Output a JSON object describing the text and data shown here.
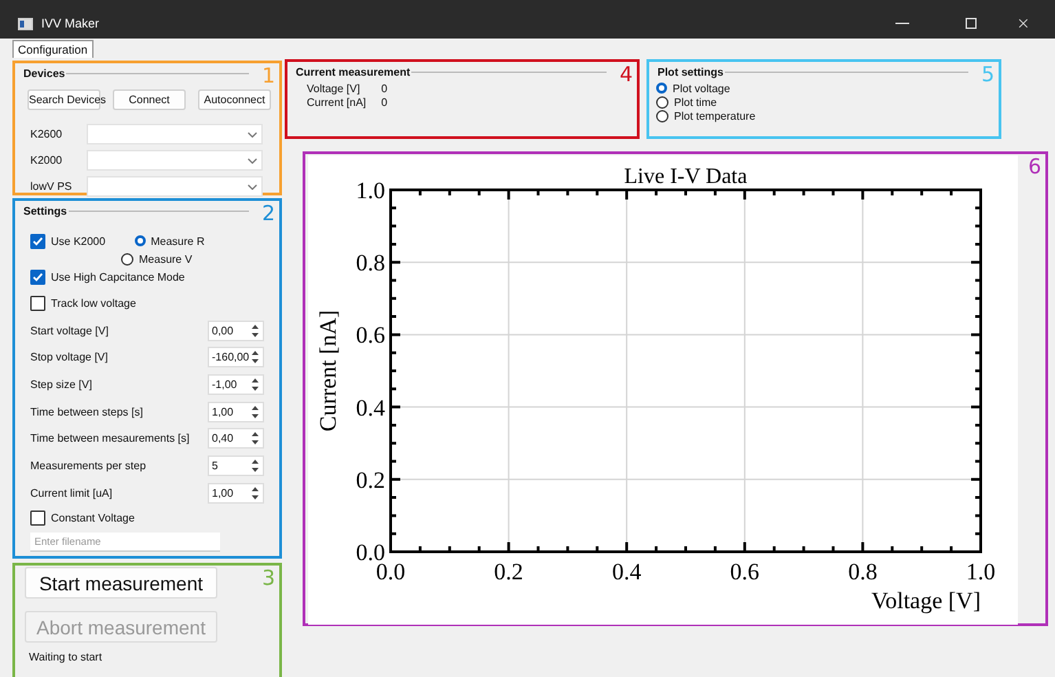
{
  "window": {
    "title": "IVV Maker"
  },
  "tabs": [
    {
      "label": "Configuration",
      "selected": true
    }
  ],
  "devices": {
    "title": "Devices",
    "marker": {
      "label": "1",
      "color": "#f7a030"
    },
    "buttons": [
      "Search Devices",
      "Connect",
      "Autoconnect"
    ],
    "selectors": [
      {
        "label": "K2600"
      },
      {
        "label": "K2000"
      },
      {
        "label": "lowV PS"
      }
    ]
  },
  "settings": {
    "title": "Settings",
    "marker": {
      "label": "2",
      "color": "#1e8fd6"
    },
    "use_k2000": {
      "label": "Use K2000",
      "checked": true
    },
    "measure_mode": [
      {
        "label": "Measure R",
        "selected": true
      },
      {
        "label": "Measure V",
        "selected": false
      }
    ],
    "high_capacitance": {
      "label": "Use High Capcitance Mode",
      "checked": true
    },
    "track_low_voltage": {
      "label": "Track low voltage",
      "checked": false
    },
    "parameters": [
      {
        "label": "Start voltage [V]",
        "value": "0,00"
      },
      {
        "label": "Stop voltage [V]",
        "value": "-160,00"
      },
      {
        "label": "Step size [V]",
        "value": "-1,00"
      },
      {
        "label": "Time between steps [s]",
        "value": "1,00"
      },
      {
        "label": "Time between mesaurements [s]",
        "value": "0,40"
      },
      {
        "label": "Measurements per step",
        "value": "5"
      },
      {
        "label": "Current limit [uA]",
        "value": "1,00"
      }
    ],
    "constant_voltage": {
      "label": "Constant Voltage",
      "checked": false
    },
    "filename": {
      "placeholder": "Enter filename"
    }
  },
  "controls": {
    "marker": {
      "label": "3",
      "color": "#7ab648"
    },
    "buttons": [
      {
        "label": "Start measurement",
        "disabled": false
      },
      {
        "label": "Abort measurement",
        "disabled": true
      }
    ],
    "status": "Waiting to start"
  },
  "current_measurement": {
    "title": "Current measurement",
    "marker": {
      "label": "4",
      "color": "#d0101e"
    },
    "readings": [
      {
        "label": "Voltage [V]",
        "value": "0"
      },
      {
        "label": "Current [nA]",
        "value": "0"
      }
    ]
  },
  "plot_settings": {
    "title": "Plot settings",
    "marker": {
      "label": "5",
      "color": "#48c4f0"
    },
    "options": [
      {
        "label": "Plot voltage",
        "selected": true
      },
      {
        "label": "Plot time",
        "selected": false
      },
      {
        "label": "Plot temperature",
        "selected": false
      }
    ]
  },
  "plot": {
    "marker": {
      "label": "6",
      "color": "#b030b8"
    },
    "chart_data": {
      "type": "line",
      "grid": true,
      "title": "Live I-V Data",
      "xlabel": "Voltage [V]",
      "ylabel": "Current [nA]",
      "xlim": [
        0,
        1
      ],
      "ylim": [
        0,
        1
      ],
      "xticks": [
        {
          "value": 0,
          "label": "0.0"
        },
        {
          "value": 0.2,
          "label": "0.2"
        },
        {
          "value": 0.4,
          "label": "0.4"
        },
        {
          "value": 0.6,
          "label": "0.6"
        },
        {
          "value": 0.8,
          "label": "0.8"
        },
        {
          "value": 1,
          "label": "1.0"
        }
      ],
      "yticks": [
        {
          "value": 0,
          "label": "0.0"
        },
        {
          "value": 0.2,
          "label": "0.2"
        },
        {
          "value": 0.4,
          "label": "0.4"
        },
        {
          "value": 0.6,
          "label": "0.6"
        },
        {
          "value": 0.8,
          "label": "0.8"
        },
        {
          "value": 1,
          "label": "1.0"
        }
      ]
    }
  }
}
